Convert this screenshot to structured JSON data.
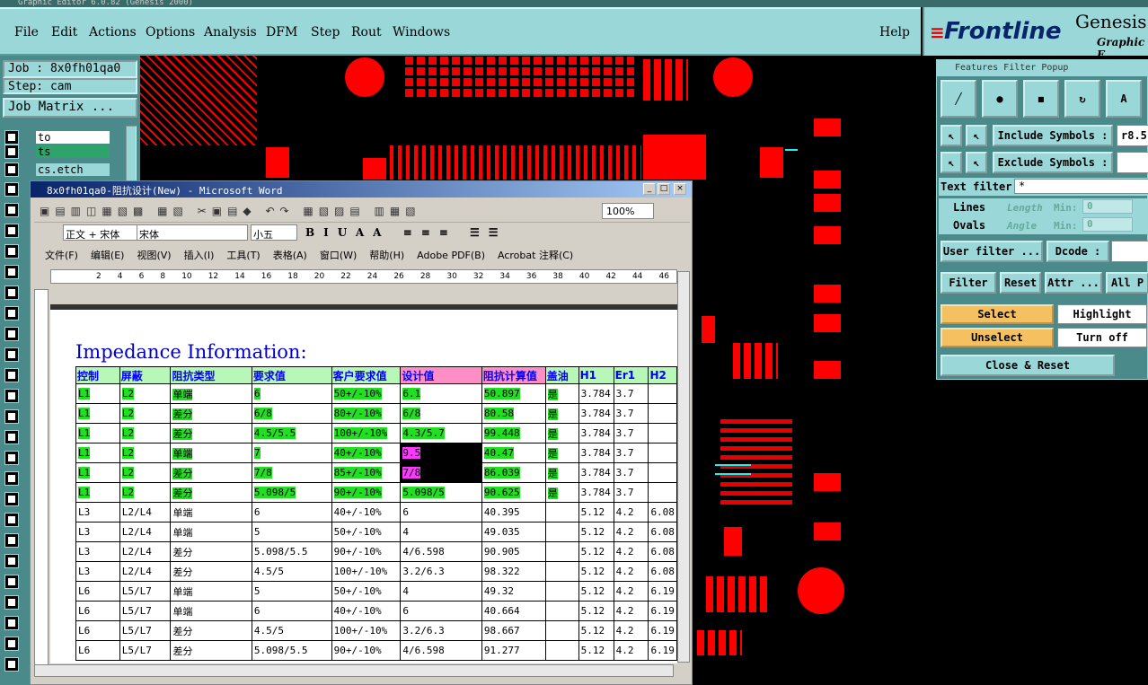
{
  "app": {
    "title": "Graphic Editor 6.0.82 (Genesis 2000)"
  },
  "menu": [
    "File",
    "Edit",
    "Actions",
    "Options",
    "Analysis",
    "DFM",
    "Step",
    "Rout",
    "Windows"
  ],
  "help": "Help",
  "logo": {
    "brand": "Frontline",
    "product": "Genesis",
    "sub": "Graphic E"
  },
  "job": {
    "job": "Job : 8x0fh01qa0",
    "step": "Step: cam",
    "matrix": "Job Matrix ..."
  },
  "layers": [
    "to",
    "ts",
    "cs.etch"
  ],
  "ffp": {
    "title": "Features Filter Popup",
    "include": "Include Symbols :",
    "exclude": "Exclude Symbols :",
    "inc_val": "r8.5",
    "text_filter": "Text filter",
    "text_val": "*",
    "lines": "Lines",
    "ovals": "Ovals",
    "length": "Length",
    "angle": "Angle",
    "min": "Min:",
    "zero": "0",
    "user_filter": "User filter ...",
    "dcode": "Dcode :",
    "filter": "Filter",
    "reset": "Reset",
    "attr": "Attr ...",
    "all": "All P",
    "select": "Select",
    "highlight": "Highlight",
    "unselect": "Unselect",
    "turnoff": "Turn off",
    "close_reset": "Close & Reset"
  },
  "word": {
    "title": "8x0fh01qa0-阻抗设计(New) - Microsoft Word",
    "style": "正文 + 宋体",
    "font": "宋体",
    "size": "小五",
    "zoom": "100%",
    "menus": [
      "文件(F)",
      "编辑(E)",
      "视图(V)",
      "插入(I)",
      "工具(T)",
      "表格(A)",
      "窗口(W)",
      "帮助(H)",
      "Adobe PDF(B)",
      "Acrobat 注释(C)"
    ],
    "ruler": [
      "2",
      "4",
      "6",
      "8",
      "10",
      "12",
      "14",
      "16",
      "18",
      "20",
      "22",
      "24",
      "26",
      "28",
      "30",
      "32",
      "34",
      "36",
      "38",
      "40",
      "42",
      "44",
      "46"
    ],
    "heading": "Impedance Information:",
    "headers": [
      "控制",
      "屏蔽",
      "阻抗类型",
      "要求值",
      "客户要求值",
      "设计值",
      "阻抗计算值",
      "盖油",
      "H1",
      "Er1",
      "H2"
    ],
    "rows": [
      [
        "L1",
        "L2",
        "单端",
        "6",
        "50+/-10%",
        "6.1",
        "50.897",
        "是",
        "3.784",
        "3.7",
        ""
      ],
      [
        "L1",
        "L2",
        "差分",
        "6/8",
        "80+/-10%",
        "6/8",
        "80.58",
        "是",
        "3.784",
        "3.7",
        ""
      ],
      [
        "L1",
        "L2",
        "差分",
        "4.5/5.5",
        "100+/-10%",
        "4.3/5.7",
        "99.448",
        "是",
        "3.784",
        "3.7",
        ""
      ],
      [
        "L1",
        "L2",
        "单端",
        "7",
        "40+/-10%",
        "9.5",
        "40.47",
        "是",
        "3.784",
        "3.7",
        ""
      ],
      [
        "L1",
        "L2",
        "差分",
        "7/8",
        "85+/-10%",
        "7/8",
        "86.039",
        "是",
        "3.784",
        "3.7",
        ""
      ],
      [
        "L1",
        "L2",
        "差分",
        "5.098/5",
        "90+/-10%",
        "5.098/5",
        "90.625",
        "是",
        "3.784",
        "3.7",
        ""
      ],
      [
        "L3",
        "L2/L4",
        "单端",
        "6",
        "40+/-10%",
        "6",
        "40.395",
        "",
        "5.12",
        "4.2",
        "6.08"
      ],
      [
        "L3",
        "L2/L4",
        "单端",
        "5",
        "50+/-10%",
        "4",
        "49.035",
        "",
        "5.12",
        "4.2",
        "6.08"
      ],
      [
        "L3",
        "L2/L4",
        "差分",
        "5.098/5.5",
        "90+/-10%",
        "4/6.598",
        "90.905",
        "",
        "5.12",
        "4.2",
        "6.08"
      ],
      [
        "L3",
        "L2/L4",
        "差分",
        "4.5/5",
        "100+/-10%",
        "3.2/6.3",
        "98.322",
        "",
        "5.12",
        "4.2",
        "6.08"
      ],
      [
        "L6",
        "L5/L7",
        "单端",
        "5",
        "50+/-10%",
        "4",
        "49.32",
        "",
        "5.12",
        "4.2",
        "6.19"
      ],
      [
        "L6",
        "L5/L7",
        "单端",
        "6",
        "40+/-10%",
        "6",
        "40.664",
        "",
        "5.12",
        "4.2",
        "6.19"
      ],
      [
        "L6",
        "L5/L7",
        "差分",
        "4.5/5",
        "100+/-10%",
        "3.2/6.3",
        "98.667",
        "",
        "5.12",
        "4.2",
        "6.19"
      ],
      [
        "L6",
        "L5/L7",
        "差分",
        "5.098/5.5",
        "90+/-10%",
        "4/6.598",
        "91.277",
        "",
        "5.12",
        "4.2",
        "6.19"
      ]
    ]
  }
}
